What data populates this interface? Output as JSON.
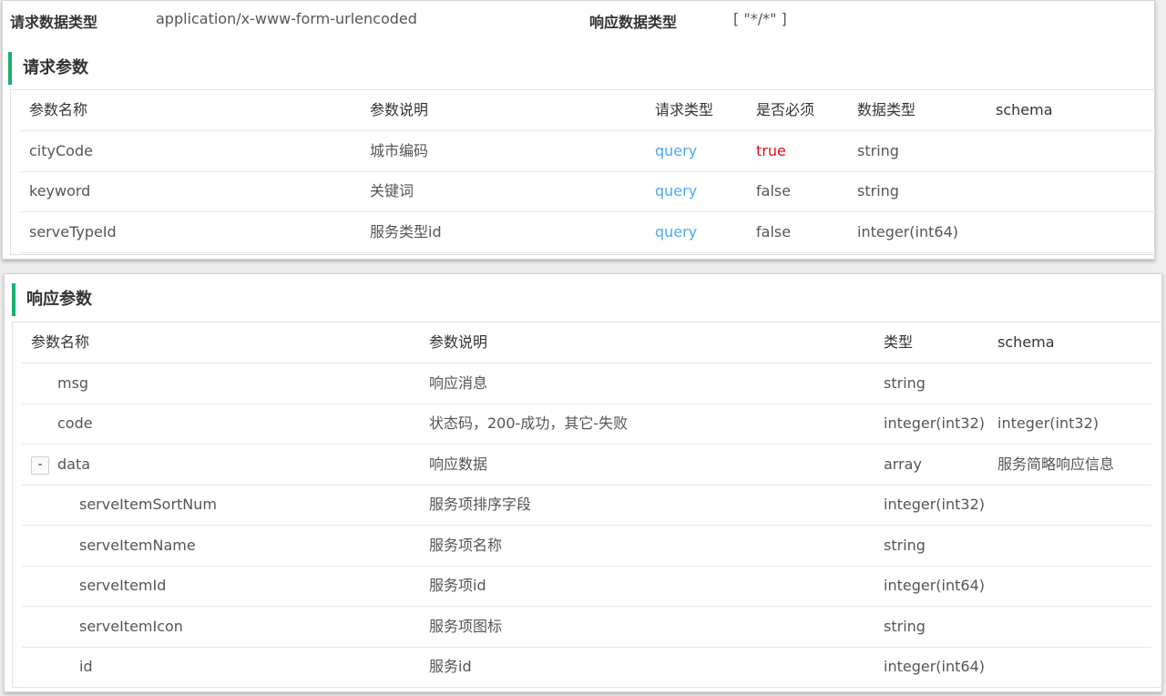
{
  "top": {
    "req_type_label": "请求数据类型",
    "req_type_value": "application/x-www-form-urlencoded",
    "resp_type_label": "响应数据类型",
    "resp_type_value": "[ \"*/*\" ]",
    "section_title": "请求参数",
    "headers": [
      "参数名称",
      "参数说明",
      "请求类型",
      "是否必须",
      "数据类型",
      "schema"
    ],
    "rows": [
      {
        "name": "cityCode",
        "desc": "城市编码",
        "in": "query",
        "required": "true",
        "type": "string",
        "schema": ""
      },
      {
        "name": "keyword",
        "desc": "关键词",
        "in": "query",
        "required": "false",
        "type": "string",
        "schema": ""
      },
      {
        "name": "serveTypeId",
        "desc": "服务类型id",
        "in": "query",
        "required": "false",
        "type": "integer(int64)",
        "schema": ""
      }
    ]
  },
  "bottom": {
    "section_title": "响应参数",
    "headers": [
      "参数名称",
      "参数说明",
      "类型",
      "schema"
    ],
    "toggle_symbol": "-",
    "rows": [
      {
        "name": "msg",
        "desc": "响应消息",
        "type": "string",
        "schema": ""
      },
      {
        "name": "code",
        "desc": "状态码，200-成功，其它-失败",
        "type": "integer(int32)",
        "schema": "integer(int32)"
      },
      {
        "name": "data",
        "desc": "响应数据",
        "type": "array",
        "schema": "服务简略响应信息"
      },
      {
        "name": "serveItemSortNum",
        "desc": "服务项排序字段",
        "type": "integer(int32)",
        "schema": ""
      },
      {
        "name": "serveItemName",
        "desc": "服务项名称",
        "type": "string",
        "schema": ""
      },
      {
        "name": "serveItemId",
        "desc": "服务项id",
        "type": "integer(int64)",
        "schema": ""
      },
      {
        "name": "serveItemIcon",
        "desc": "服务项图标",
        "type": "string",
        "schema": ""
      },
      {
        "name": "id",
        "desc": "服务id",
        "type": "integer(int64)",
        "schema": ""
      }
    ]
  },
  "colors": {
    "accent": "#19b16c",
    "query": "#4da8f5",
    "true": "#e01010"
  }
}
